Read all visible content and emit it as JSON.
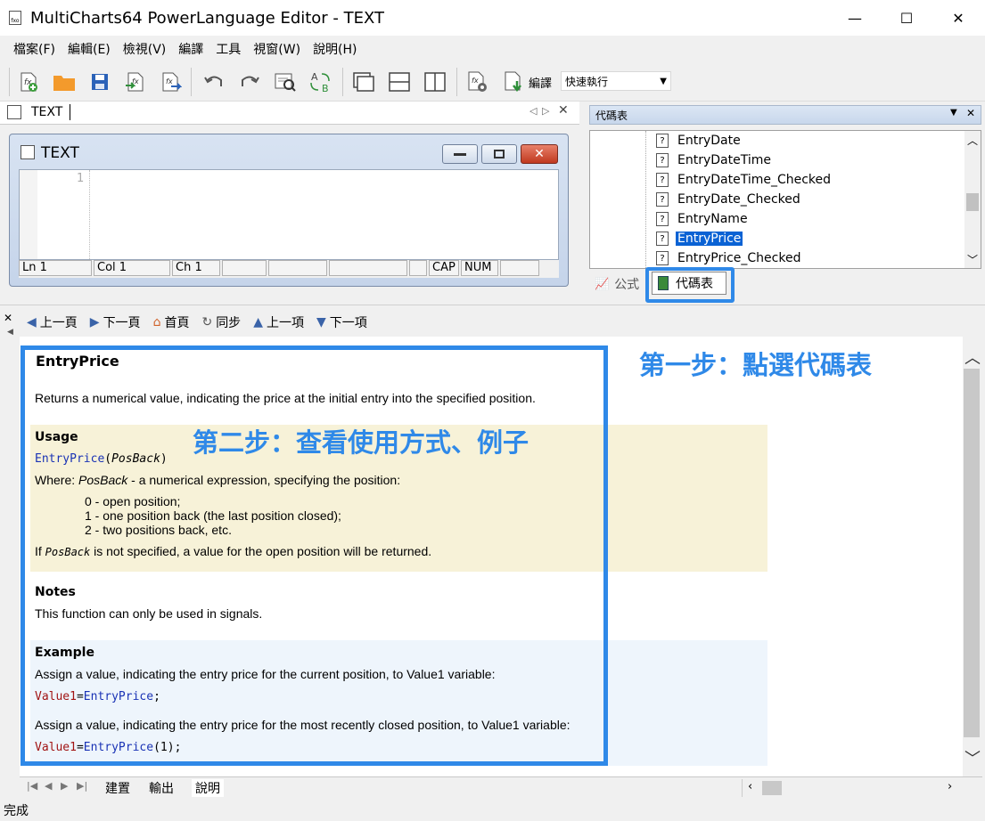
{
  "window": {
    "title": "MultiCharts64 PowerLanguage Editor - TEXT",
    "minimize": "—",
    "maximize": "☐",
    "close": "✕"
  },
  "menu": [
    "檔案(F)",
    "編輯(E)",
    "檢視(V)",
    "編譯",
    "工具",
    "視窗(W)",
    "說明(H)"
  ],
  "toolbar": {
    "compile_label": "編譯",
    "mode_value": "快速執行"
  },
  "doc_tab": {
    "label": "TEXT"
  },
  "editor": {
    "window_title": "TEXT",
    "line_number": "1",
    "status": {
      "ln": "Ln 1",
      "col": "Col 1",
      "ch": "Ch 1",
      "cap": "CAP",
      "num": "NUM"
    }
  },
  "right_panel": {
    "header": "代碼表",
    "items": [
      "EntryDate",
      "EntryDateTime",
      "EntryDateTime_Checked",
      "EntryDate_Checked",
      "EntryName",
      "EntryPrice",
      "EntryPrice_Checked"
    ],
    "selected_index": 5,
    "tabs": {
      "formula": "公式",
      "codes": "代碼表"
    }
  },
  "help_nav": {
    "prev_page": "上一頁",
    "next_page": "下一頁",
    "home": "首頁",
    "sync": "同步",
    "prev_item": "上一項",
    "next_item": "下一項"
  },
  "help": {
    "title": "EntryPrice",
    "description": "Returns a numerical value, indicating the price at the initial entry into the specified position.",
    "usage_heading": "Usage",
    "usage_func": "EntryPrice",
    "usage_open": "(",
    "usage_param": "PosBack",
    "usage_close": ")",
    "where_prefix": "Where: ",
    "where_param": "PosBack",
    "where_suffix": " - a numerical expression, specifying the position:",
    "options": [
      "0 - open position;",
      "1 - one position back (the last position closed);",
      "2 - two positions back, etc."
    ],
    "ifnot_prefix": "If ",
    "ifnot_param": "PosBack",
    "ifnot_suffix": " is not specified, a value for the open position will be returned.",
    "notes_heading": "Notes",
    "notes_text": "This function can only be used in signals.",
    "example_heading": "Example",
    "example1_text": "Assign a value, indicating the entry price for the current position, to Value1 variable:",
    "example1_var": "Value1",
    "example1_eq": "=",
    "example1_func": "EntryPrice",
    "example1_end": ";",
    "example2_text": "Assign a value, indicating the entry price for the most recently closed position, to Value1 variable:",
    "example2_var": "Value1",
    "example2_eq": "=",
    "example2_func": "EntryPrice",
    "example2_args": "(1)",
    "example2_end": ";"
  },
  "annotations": {
    "step1": "第一步：點選代碼表",
    "step2": "第二步：查看使用方式、例子"
  },
  "bottom_tabs": [
    "建置",
    "輸出",
    "說明"
  ],
  "app_status": "完成",
  "colors": {
    "annotation": "#2f89e8",
    "selection": "#0a62d4",
    "usage_bg": "#f7f2d8",
    "example_bg": "#eef5fc"
  }
}
